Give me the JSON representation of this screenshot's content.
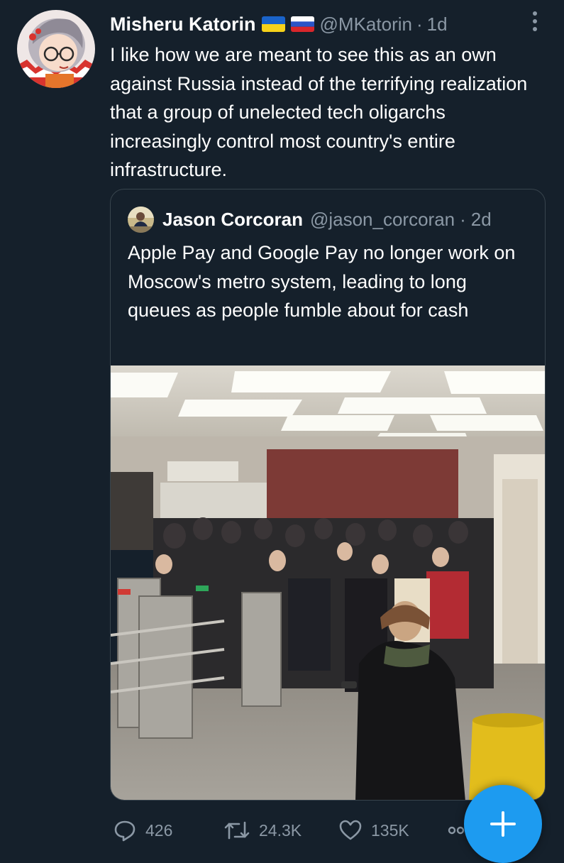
{
  "tweet": {
    "display_name": "Misheru Katorin",
    "flags": [
      "ukraine-flag",
      "russia-flag"
    ],
    "handle": "@MKatorin",
    "separator": "·",
    "time": "1d",
    "text": "I like how we are meant to see this as an own against Russia instead of the terrifying realization that a group of unelected tech oligarchs increasingly control most country's entire infrastructure."
  },
  "quoted_tweet": {
    "display_name": "Jason Corcoran",
    "handle": "@jason_corcoran",
    "separator": "·",
    "time": "2d",
    "text": "Apple Pay and Google Pay no longer work on Moscow's metro system, leading to long queues as people fumble about for cash",
    "image_description": "Crowd queuing at metro station turnstiles"
  },
  "actions": {
    "replies": "426",
    "retweets": "24.3K",
    "likes": "135K",
    "share_icon": "share-icon"
  },
  "fab": {
    "icon": "compose-plus-icon"
  },
  "colors": {
    "background": "#15202b",
    "text_primary": "#ffffff",
    "text_secondary": "#8b98a5",
    "border": "#38444d",
    "accent": "#1d9bf0"
  }
}
